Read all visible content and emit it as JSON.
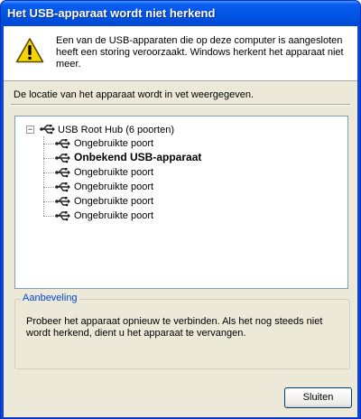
{
  "window": {
    "title": "Het USB-apparaat wordt niet herkend"
  },
  "header": {
    "icon": "warning-icon",
    "message": "Een van de USB-apparaten die op deze computer is aangesloten heeft een storing veroorzaakt. Windows herkent het apparaat niet meer."
  },
  "location_text": "De locatie van het apparaat wordt in vet weergegeven.",
  "tree": {
    "expander": "−",
    "root": {
      "label": "USB Root Hub (6 poorten)",
      "icon": "usb-icon"
    },
    "children": [
      {
        "label": "Ongebruikte poort",
        "bold": false,
        "icon": "usb-icon"
      },
      {
        "label": "Onbekend USB-apparaat",
        "bold": true,
        "icon": "usb-icon"
      },
      {
        "label": "Ongebruikte poort",
        "bold": false,
        "icon": "usb-icon"
      },
      {
        "label": "Ongebruikte poort",
        "bold": false,
        "icon": "usb-icon"
      },
      {
        "label": "Ongebruikte poort",
        "bold": false,
        "icon": "usb-icon"
      },
      {
        "label": "Ongebruikte poort",
        "bold": false,
        "icon": "usb-icon"
      }
    ]
  },
  "recommendation": {
    "title": "Aanbeveling",
    "text": "Probeer het apparaat opnieuw te verbinden. Als het nog steeds niet wordt herkend, dient u het apparaat te vervangen."
  },
  "buttons": {
    "close": "Sluiten"
  },
  "colors": {
    "titlebar": "#0054e3",
    "dialog_bg": "#ece9d8",
    "group_title": "#0046d5"
  }
}
